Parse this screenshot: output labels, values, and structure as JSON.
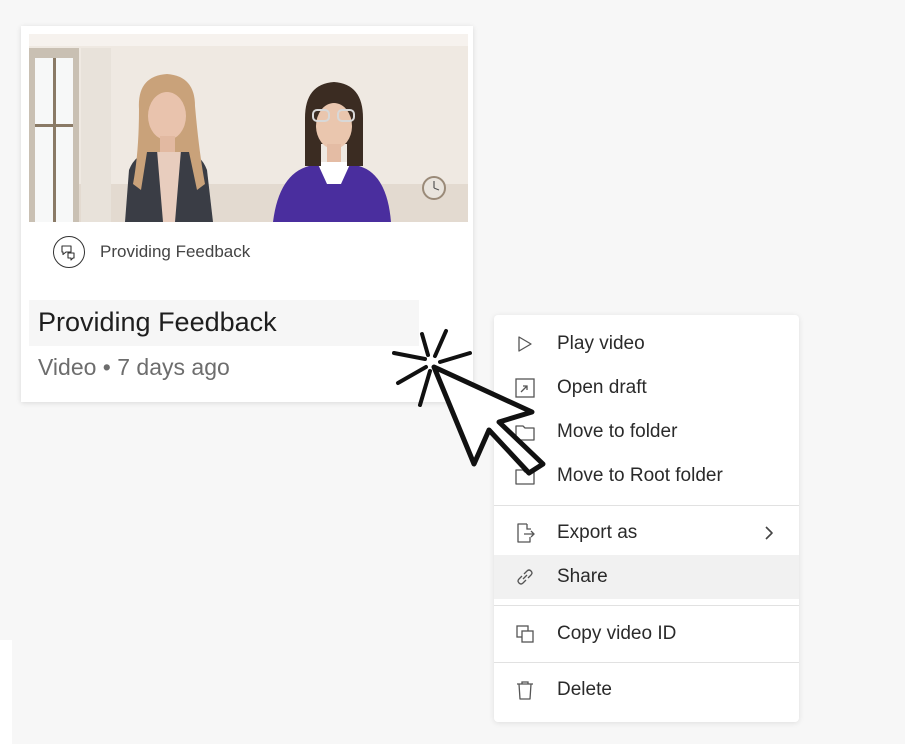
{
  "card": {
    "template_label": "Providing Feedback",
    "title": "Providing Feedback",
    "meta": "Video • 7 days ago"
  },
  "menu": {
    "items": [
      {
        "label": "Play video",
        "icon": "play-icon"
      },
      {
        "label": "Open draft",
        "icon": "open-draft-icon"
      },
      {
        "label": "Move to folder",
        "icon": "folder-icon"
      },
      {
        "label": "Move to Root folder",
        "icon": "folder-icon"
      },
      {
        "label": "Export as",
        "icon": "export-icon"
      },
      {
        "label": "Share",
        "icon": "link-icon",
        "highlighted": true
      },
      {
        "label": "Copy video ID",
        "icon": "copy-icon"
      },
      {
        "label": "Delete",
        "icon": "trash-icon"
      }
    ]
  }
}
